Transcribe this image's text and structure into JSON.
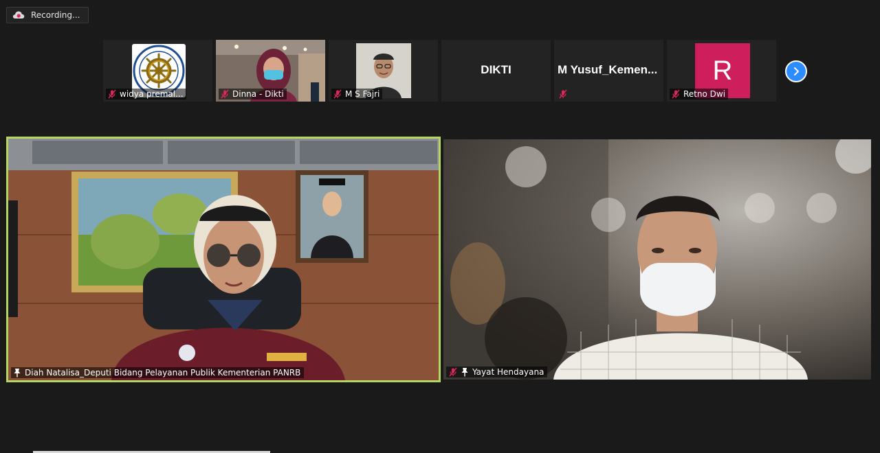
{
  "recording": {
    "label": "Recording..."
  },
  "thumbnails": [
    {
      "name": "widya premal...",
      "type": "logo",
      "muted": true
    },
    {
      "name": "Dinna - Dikti",
      "type": "video",
      "muted": true
    },
    {
      "name": "M S Fajri",
      "type": "photo",
      "muted": true
    },
    {
      "name": "DIKTI",
      "type": "text",
      "muted": false
    },
    {
      "name": "M  Yusuf_Kemen...",
      "type": "text",
      "muted": true
    },
    {
      "name": "Retno Dwi",
      "type": "avatar",
      "avatar_letter": "R",
      "avatar_color": "#cf1e5c",
      "muted": true
    }
  ],
  "main_videos": [
    {
      "name": "Diah Natalisa_Deputi Bidang Pelayanan Publik Kementerian PANRB",
      "pinned": true,
      "muted": false,
      "active_speaker": true,
      "highlight_color": "#b5d661"
    },
    {
      "name": "Yayat Hendayana",
      "pinned": true,
      "muted": true,
      "active_speaker": false
    }
  ],
  "icons": {
    "recording": "cloud-record-icon",
    "mic_off": "mic-off-icon",
    "pin": "pin-icon",
    "next": "chevron-right-icon"
  },
  "colors": {
    "accent": "#2d8cff",
    "muted_icon": "#e0245e",
    "background": "#1a1a1a"
  }
}
